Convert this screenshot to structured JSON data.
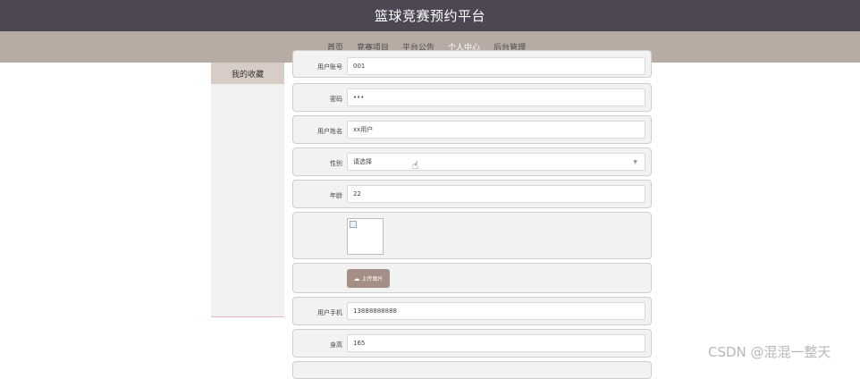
{
  "header": {
    "title": "篮球竞赛预约平台"
  },
  "nav": {
    "items": [
      {
        "label": "首页",
        "active": false
      },
      {
        "label": "竞赛项目",
        "active": false
      },
      {
        "label": "平台公告",
        "active": false
      },
      {
        "label": "个人中心",
        "active": true
      },
      {
        "label": "后台管理",
        "active": false
      }
    ]
  },
  "sidebar": {
    "items": [
      {
        "label": "我的收藏"
      }
    ]
  },
  "form": {
    "account": {
      "label": "用户账号",
      "value": "001"
    },
    "password": {
      "label": "密码",
      "value": "•••"
    },
    "name": {
      "label": "用户姓名",
      "value": "xx用户"
    },
    "gender": {
      "label": "性别",
      "value": "请选择"
    },
    "age": {
      "label": "年龄",
      "value": "22"
    },
    "upload": {
      "label": "上传图片"
    },
    "phone": {
      "label": "用户手机",
      "value": "13888888888"
    },
    "height": {
      "label": "身高",
      "value": "165"
    }
  },
  "watermark": "CSDN @混混一整天",
  "colors": {
    "header_bg": "#4c4752",
    "nav_bg": "#b7aba3",
    "accent": "#a58e85"
  }
}
